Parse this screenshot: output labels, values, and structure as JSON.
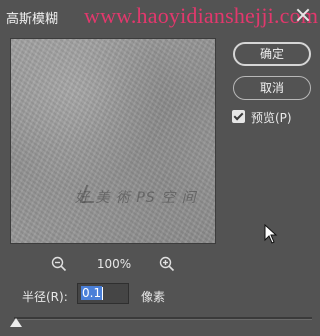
{
  "dialog": {
    "title": "高斯模糊",
    "watermark_url": "www.haoyidianshejji.com"
  },
  "preview": {
    "watermark_text": "好 美 術 PS 空 间"
  },
  "buttons": {
    "ok_label": "确定",
    "cancel_label": "取消"
  },
  "preview_toggle": {
    "label": "预览(P)",
    "checked": true
  },
  "zoom": {
    "level": "100%",
    "zoom_out_icon": "zoom-out-icon",
    "zoom_in_icon": "zoom-in-icon"
  },
  "radius": {
    "label": "半径(R):",
    "value": "0.1",
    "unit": "像素",
    "slider_fraction": 0.0
  }
}
